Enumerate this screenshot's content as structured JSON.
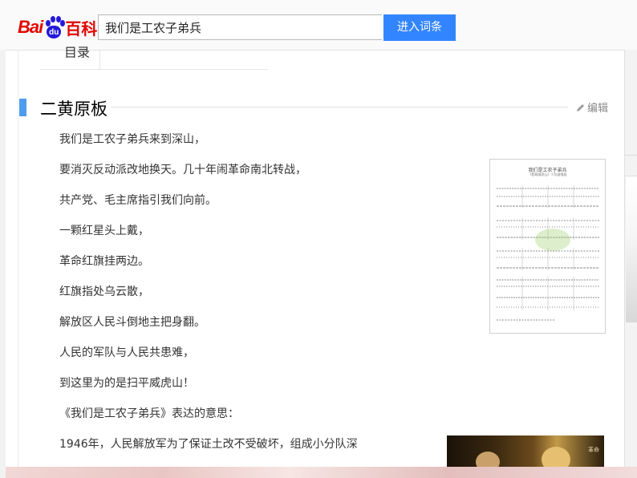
{
  "header": {
    "logo": {
      "text_bai": "Bai",
      "text_du": "du",
      "text_baike": "百科",
      "color": "#e10601",
      "paw_color": "#2319dc"
    },
    "search": {
      "value": "我们是工农子弟兵",
      "button_label": "进入词条",
      "button_color": "#3385ff"
    }
  },
  "toc": {
    "label": "目录"
  },
  "section": {
    "title": "二黄原板",
    "edit_label": "编辑",
    "accent_color": "#4f9cee",
    "lines": [
      "我们是工农子弟兵来到深山，",
      "要消灭反动派改地换天。几十年闹革命南北转战，",
      "共产党、毛主席指引我们向前。",
      "一颗红星头上戴，",
      "革命红旗挂两边。",
      "红旗指处乌云散，",
      "解放区人民斗倒地主把身翻。",
      "人民的军队与人民共患难，",
      "到这里为的是扫平威虎山！",
      "《我们是工农子弟兵》表达的意思：",
      "1946年，人民解放军为了保证土改不受破坏，组成小分队深"
    ]
  },
  "score_image": {
    "title": "我们是工农子弟兵",
    "subtitle": "《智取威虎山》少剑波唱段"
  },
  "photo": {
    "caption": "革命"
  }
}
